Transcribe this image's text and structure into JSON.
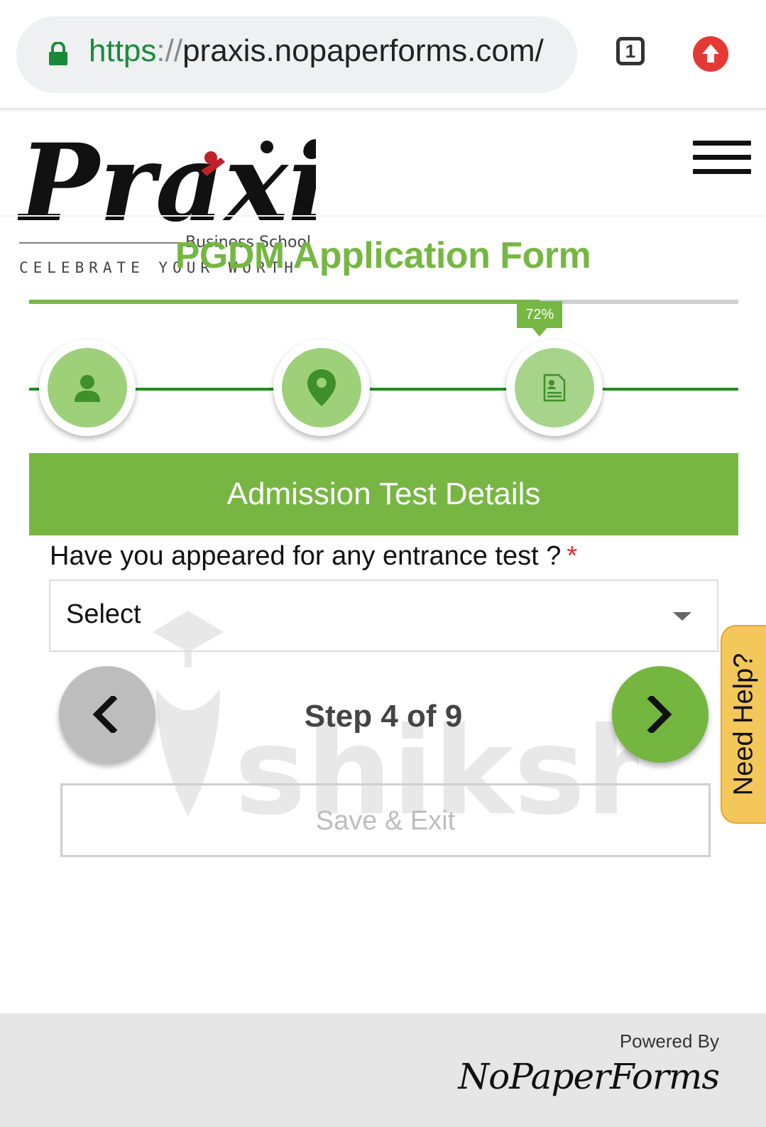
{
  "browser": {
    "url_scheme": "https",
    "url_sep": "://",
    "url_rest": "praxis.nopaperforms.com/",
    "tab_count": "1"
  },
  "header": {
    "logo_text": "Praxis",
    "logo_subtitle": "Business School",
    "logo_tagline": "CELEBRATE YOUR WORTH"
  },
  "form": {
    "title": "PGDM Application Form",
    "progress_percent": 72,
    "progress_label": "72%",
    "steps": [
      {
        "icon": "person-icon"
      },
      {
        "icon": "location-pin-icon"
      },
      {
        "icon": "document-icon"
      }
    ],
    "section_title": "Admission Test Details",
    "question": "Have you appeared for any entrance test ?",
    "required_mark": "*",
    "select_value": "Select",
    "step_indicator": "Step 4 of 9",
    "save_exit_label": "Save & Exit"
  },
  "watermark": {
    "text": "shiksha"
  },
  "help": {
    "label": "Need Help?"
  },
  "footer": {
    "powered_by": "Powered By",
    "brand": "NoPaperForms"
  },
  "colors": {
    "brand_green": "#76b743",
    "step_line": "#1e8f1e",
    "help_tab": "#f4c75a",
    "required": "#e03030"
  }
}
